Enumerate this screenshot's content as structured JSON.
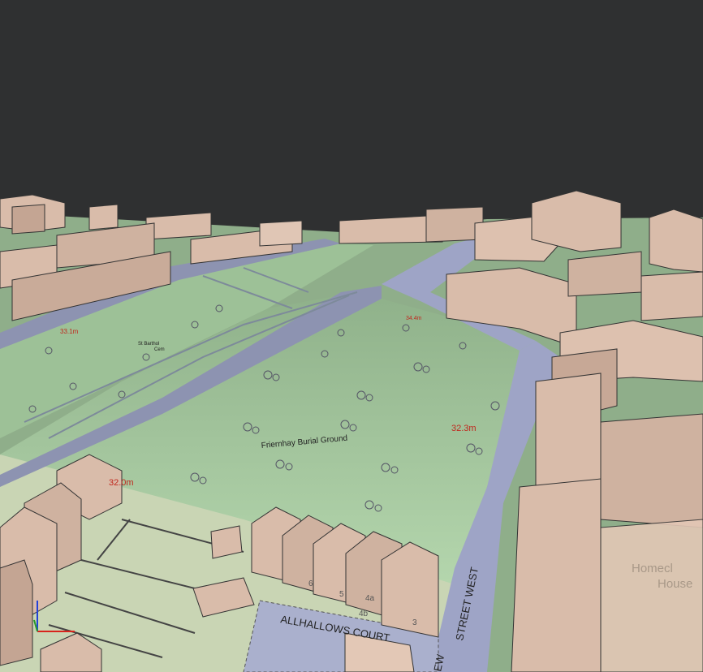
{
  "map": {
    "park_label": "Friernhay Burial Ground",
    "church_label_line1": "St Barthol",
    "church_label_line2": "Cem",
    "road_label_street": "STREET WEST",
    "road_label_prefix": "EW",
    "court_label": "ALLHALLOWS COURT",
    "house_label_line1": "Homecl",
    "house_label_line2": "House",
    "spot_height_1": "32.3m",
    "spot_height_2": "32.0m",
    "spot_height_3": "34.4m",
    "spot_height_4": "33.1m",
    "house_numbers": [
      "6",
      "5",
      "4a",
      "4b",
      "3"
    ]
  },
  "colors": {
    "sky": "#2f3031",
    "park": "#a9cba3",
    "road": "#9ea4c6",
    "building": "#d9bcaa",
    "label_red": "#c0281e"
  },
  "axis_gizmo": {
    "x_color": "#d8231c",
    "y_color": "#2a9a2a",
    "z_color": "#2241d8"
  }
}
